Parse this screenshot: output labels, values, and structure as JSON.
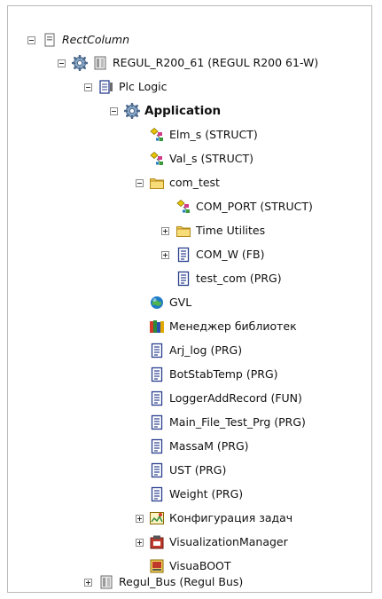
{
  "tree": {
    "project": {
      "label": "RectColumn",
      "icon": "project-icon"
    },
    "device": {
      "label": "REGUL_R200_61 (REGUL R200 61-W)",
      "icon": "device-icon"
    },
    "plc_logic": {
      "label": "Plc Logic",
      "icon": "plc-logic-icon"
    },
    "application": {
      "label": "Application",
      "icon": "application-gear-icon"
    },
    "items": [
      {
        "label": "Elm_s (STRUCT)",
        "icon": "struct-icon"
      },
      {
        "label": "Val_s (STRUCT)",
        "icon": "struct-icon"
      },
      {
        "label": "com_test",
        "icon": "folder-icon"
      },
      {
        "label": "COM_PORT (STRUCT)",
        "icon": "struct-icon"
      },
      {
        "label": "Time Utilites",
        "icon": "folder-icon"
      },
      {
        "label": "COM_W (FB)",
        "icon": "pou-icon"
      },
      {
        "label": "test_com (PRG)",
        "icon": "pou-icon"
      },
      {
        "label": "GVL",
        "icon": "gvl-globe-icon"
      },
      {
        "label": "Менеджер библиотек",
        "icon": "library-manager-icon"
      },
      {
        "label": "Arj_log (PRG)",
        "icon": "pou-icon"
      },
      {
        "label": "BotStabTemp (PRG)",
        "icon": "pou-icon"
      },
      {
        "label": "LoggerAddRecord (FUN)",
        "icon": "pou-icon"
      },
      {
        "label": "Main_File_Test_Prg (PRG)",
        "icon": "pou-icon"
      },
      {
        "label": "MassaM (PRG)",
        "icon": "pou-icon"
      },
      {
        "label": "UST (PRG)",
        "icon": "pou-icon"
      },
      {
        "label": "Weight (PRG)",
        "icon": "pou-icon"
      },
      {
        "label": "Конфигурация задач",
        "icon": "task-config-icon"
      },
      {
        "label": "VisualizationManager",
        "icon": "visualization-manager-icon"
      },
      {
        "label": "VisuaBOOT",
        "icon": "visualization-icon"
      }
    ],
    "bus": {
      "label": "Regul_Bus (Regul Bus)",
      "icon": "bus-icon"
    }
  },
  "colors": {
    "folder": "#f1cf5a",
    "gear": "#8aa8c8",
    "page_border": "#2a3f8f",
    "globe": "#1f7cc4",
    "struct_diamond": "#d9b000",
    "struct_pink": "#d23a8a"
  }
}
